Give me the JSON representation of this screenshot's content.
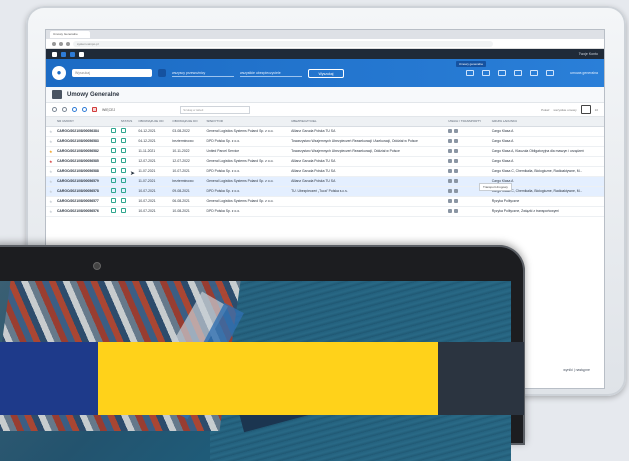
{
  "browser": {
    "tab_label": "Umowy Generalne",
    "url": "system.wmpo.pl"
  },
  "topbar": {
    "user": "Twoje Konto"
  },
  "header": {
    "search_placeholder": "Wyszukaj",
    "select_1": "wszyscy przewoźnicy",
    "select_2": "wszystkie ubezpieczyciele",
    "button": "Wyszukaj",
    "tooltip": "Umowy generalne",
    "user_label": "umowa generalna"
  },
  "page": {
    "title": "Umowy Generalne"
  },
  "toolbar": {
    "count_label": "WIĘCEJ",
    "search_placeholder": "Szukaj w tabeli",
    "right_label": "Pokaż",
    "right_select": "wszystkie umowy",
    "page_size": "10"
  },
  "table": {
    "headers": [
      "",
      "NR UMOWY",
      "",
      "STATUS",
      "OBOWIĄZUJE OD",
      "OBOWIĄZUJE DO",
      "SPEDYTOR",
      "UBEZPIECZYCIEL",
      "UWAGI / TRANSPORTY",
      "GRUPA LADUNKU"
    ],
    "rows": [
      {
        "star": "",
        "num": "CARGO/2021/08/00056384",
        "from": "04-12-2021",
        "to": "03-08-2022",
        "forwarder": "General Logistics Systems Poland Sp. z o.o.",
        "insurer": "Allianz Garuda Polska TU SA",
        "cargo": "Cargo Klasa A"
      },
      {
        "star": "",
        "num": "CARGO/2021/08/00056583",
        "from": "04-12-2021",
        "to": "bezterminowo",
        "forwarder": "DPD Polska Sp. z o.o.",
        "insurer": "Towarzystwo Wzajemnych Ubezpieczeń Reasekuracji i Asekuracji, Oddział w Polsce",
        "cargo": "Cargo Klasa A"
      },
      {
        "star": "o",
        "num": "CARGO/2021/08/00056582",
        "from": "11-11-2021",
        "to": "10-11-2022",
        "forwarder": "United Parcel Service",
        "insurer": "Towarzystwo Wzajemnych Ubezpieczeń Reasekuracji, Oddział w Polsce",
        "cargo": "Cargo Klasa A, Klauzula Obligatoryjna dla maszyn i urządzeń"
      },
      {
        "star": "r",
        "num": "CARGO/2021/08/00056585",
        "from": "12-07-2021",
        "to": "12-07-2022",
        "forwarder": "General Logistics Systems Poland Sp. z o.o.",
        "insurer": "Allianz Garuda Polska TU SA",
        "cargo": "Cargo Klasa A"
      },
      {
        "star": "",
        "num": "CARGO/2021/08/00056588",
        "from": "11-07-2021",
        "to": "10-07-2021",
        "forwarder": "DPD Polska Sp. z o.o.",
        "insurer": "Allianz Garuda Polska TU SA",
        "cargo": "Cargo Klasa C, Chemikalia, Biologiczne, Radioaktywne, M..."
      },
      {
        "star": "",
        "num": "CARGO/2021/08/00056579",
        "from": "11-07-2021",
        "to": "bezterminowo",
        "forwarder": "General Logistics Systems Poland Sp. z o.o.",
        "insurer": "Allianz Garuda Polska TU SA",
        "cargo": "Cargo Klasa A"
      },
      {
        "star": "",
        "num": "CARGO/2021/08/00056578",
        "from": "10-07-2021",
        "to": "09-08-2021",
        "forwarder": "DPD Polska Sp. z o.o.",
        "insurer": "TU. Ubezpieczeń „Tuca” Polska s.c.s.",
        "cargo": "Cargo Klasa C, Chemikalia, Biologiczne, Radioaktywne, M..."
      },
      {
        "star": "",
        "num": "CARGO/2021/08/00056577",
        "from": "10-07-2021",
        "to": "06-08-2021",
        "forwarder": "General Logistics Systems Poland Sp. z o.o.",
        "insurer": "",
        "cargo": "Ryzyka Polityczne"
      },
      {
        "star": "",
        "num": "CARGO/2021/08/00056576",
        "from": "10-07-2021",
        "to": "10-08-2021",
        "forwarder": "DPD Polska Sp. z o.o.",
        "insurer": "",
        "cargo": "Ryzyka Polityczne, Związki z transportowymi"
      }
    ]
  },
  "row_tooltip": "Transport drogowy",
  "pagination": "wyniki | następne"
}
